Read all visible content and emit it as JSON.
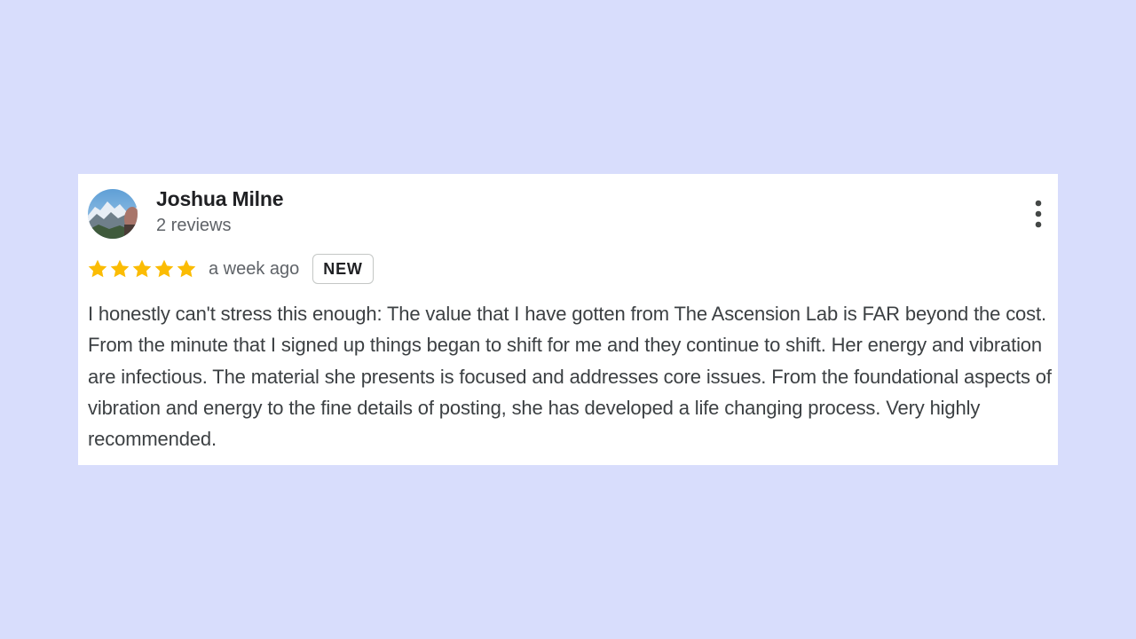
{
  "review": {
    "reviewer_name": "Joshua Milne",
    "review_count": "2 reviews",
    "rating": 5,
    "max_rating": 5,
    "date": "a week ago",
    "badge": "NEW",
    "text": "I honestly can't stress this enough: The value that I have gotten from The Ascension Lab is FAR beyond the cost. From the minute that I signed up things began to shift for me and they continue to shift. Her energy and vibration are infectious. The material she presents is focused and addresses core issues. From the foundational aspects of vibration and energy to the fine details of posting, she has developed a life changing process. Very highly recommended."
  },
  "icons": {
    "avatar": "avatar-photo-mountain",
    "more": "more-vert-icon",
    "star": "star-icon"
  },
  "colors": {
    "background": "#d8ddfc",
    "card": "#ffffff",
    "star": "#fbbc04",
    "name": "#202124",
    "secondary_text": "#5f6368",
    "body_text": "#3c4043"
  }
}
